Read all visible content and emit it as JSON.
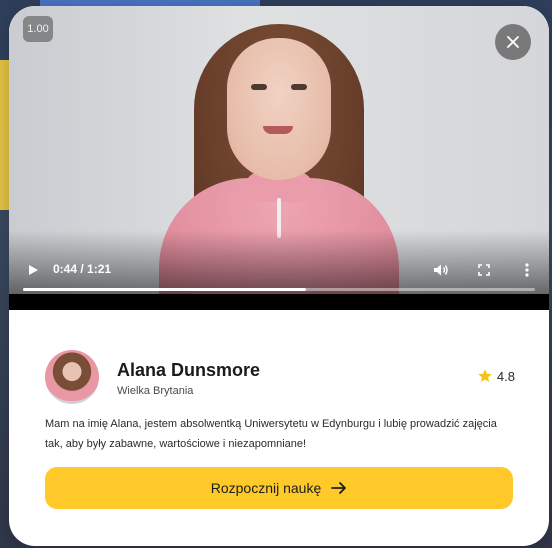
{
  "player": {
    "speed_label": "1.00",
    "time_display": "0:44 / 1:21",
    "progress": 0.553
  },
  "tutor": {
    "name": "Alana Dunsmore",
    "country": "Wielka Brytania",
    "rating": "4.8",
    "bio": "Mam na imię Alana, jestem absolwentką Uniwersytetu w Edynburgu i lubię prowadzić zajęcia tak, aby były zabawne, wartościowe i niezapomniane!"
  },
  "cta": {
    "label": "Rozpocznij naukę"
  },
  "colors": {
    "accent": "#ffc929",
    "star": "#f6c21b"
  },
  "icons": [
    "close-icon",
    "play-icon",
    "volume-icon",
    "fullscreen-icon",
    "more-vertical-icon",
    "star-icon",
    "arrow-right-icon"
  ]
}
